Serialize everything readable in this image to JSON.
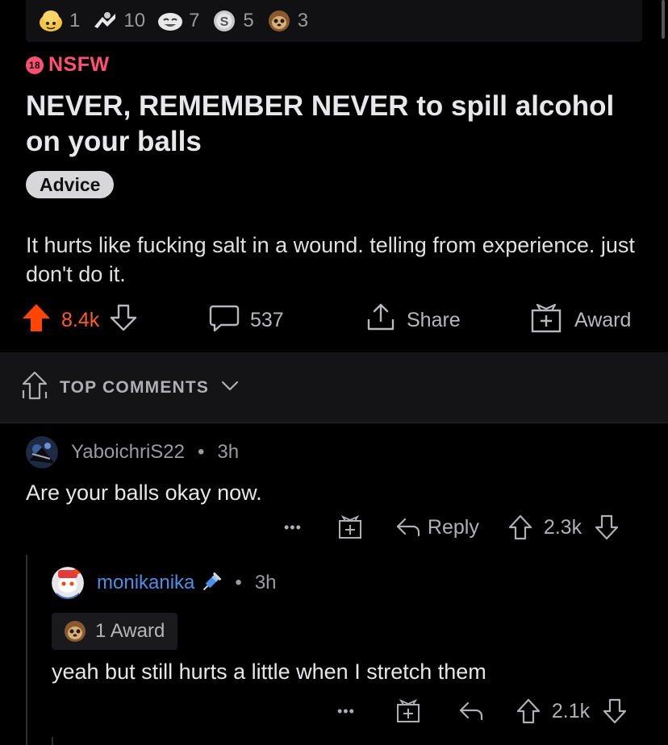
{
  "awards": [
    {
      "icon": "helpful-award-icon",
      "count": "1"
    },
    {
      "icon": "wholesome-award-icon",
      "count": "10"
    },
    {
      "icon": "laughing-award-icon",
      "count": "7"
    },
    {
      "icon": "silver-award-icon",
      "count": "5"
    },
    {
      "icon": "sloth-award-icon",
      "count": "3"
    }
  ],
  "post": {
    "nsfw_badge": "18",
    "nsfw_label": "NSFW",
    "title": "NEVER, REMEMBER NEVER to spill alcohol on your balls",
    "flair": "Advice",
    "body": "It hurts like fucking salt in a wound. telling from experience. just don't do it.",
    "votes": "8.4k",
    "comments": "537",
    "share_label": "Share",
    "award_label": "Award"
  },
  "sort": {
    "label": "TOP COMMENTS"
  },
  "comments": [
    {
      "username": "YaboichriS22",
      "separator": "•",
      "time": "3h",
      "text": "Are your balls okay now.",
      "more": "•••",
      "reply_label": "Reply",
      "votes": "2.3k"
    },
    {
      "username": "monikanika",
      "separator": "•",
      "time": "3h",
      "award_text": "1 Award",
      "text": "yeah but still hurts a little when I stretch them",
      "more": "•••",
      "votes": "2.1k"
    }
  ],
  "colors": {
    "upvote": "#ff4500",
    "nsfw": "#ff4f73",
    "username_highlight": "#4a8fe7"
  }
}
